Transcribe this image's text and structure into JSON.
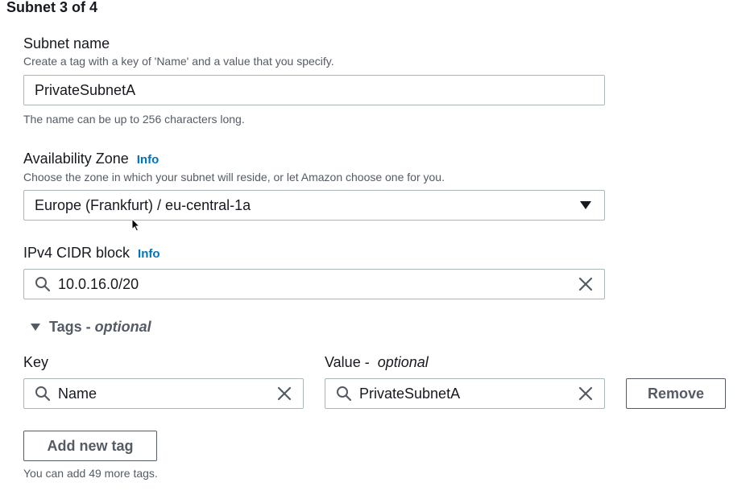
{
  "section": {
    "title": "Subnet 3 of 4"
  },
  "subnet_name": {
    "label": "Subnet name",
    "description": "Create a tag with a key of 'Name' and a value that you specify.",
    "value": "PrivateSubnetA",
    "hint": "The name can be up to 256 characters long."
  },
  "availability_zone": {
    "label": "Availability Zone",
    "info": "Info",
    "description": "Choose the zone in which your subnet will reside, or let Amazon choose one for you.",
    "selected": "Europe (Frankfurt) / eu-central-1a"
  },
  "cidr": {
    "label": "IPv4 CIDR block",
    "info": "Info",
    "value": "10.0.16.0/20"
  },
  "tags": {
    "toggle_label": "Tags - ",
    "toggle_optional": "optional",
    "key_label": "Key",
    "value_label": "Value - ",
    "value_optional": "optional",
    "rows": [
      {
        "key": "Name",
        "value": "PrivateSubnetA",
        "remove_label": "Remove"
      }
    ],
    "add_label": "Add new tag",
    "limit_hint": "You can add 49 more tags."
  },
  "colors": {
    "link": "#0073bb",
    "border": "#aab7b8",
    "text": "#16191f",
    "muted": "#545b64"
  },
  "icons": [
    "search-icon",
    "clear-icon",
    "caret-down-icon",
    "triangle-expanded-icon",
    "mouse-cursor-icon"
  ]
}
